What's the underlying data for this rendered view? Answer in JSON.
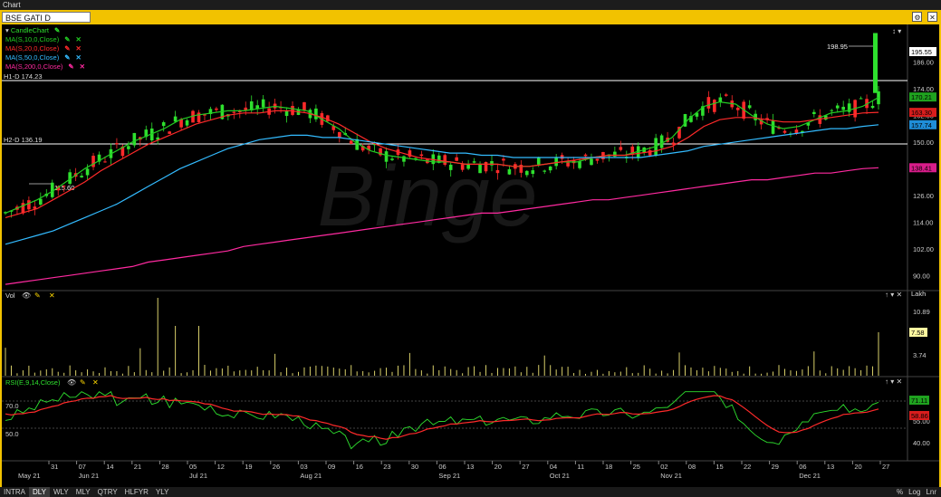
{
  "window": {
    "title": "Chart"
  },
  "symbol": "BSE GATI D",
  "watermark": "Binge",
  "price_panel": {
    "legend": [
      {
        "label": "CandleChart",
        "color": "#2ee02e"
      },
      {
        "label": "MA(S,10,0,Close)",
        "color": "#22cc22"
      },
      {
        "label": "MA(S,20,0,Close)",
        "color": "#ff2a2a"
      },
      {
        "label": "MA(S,50,0,Close)",
        "color": "#33bbff"
      },
      {
        "label": "MA(S,200,0,Close)",
        "color": "#ff2aa0"
      }
    ],
    "h1_label": "H1-D 174.23",
    "h2_label": "H2-D 136.19",
    "high_label": "198.95",
    "low_label": "115.60",
    "y_ticks": [
      "195.55",
      "186.00",
      "174.00",
      "162.00",
      "150.00",
      "138.00",
      "126.00",
      "114.00",
      "102.00",
      "90.00"
    ],
    "y_tick_values": [
      186,
      174,
      162,
      150,
      138,
      126,
      114,
      102,
      90
    ],
    "last_price": "195.55",
    "badges": [
      {
        "text": "170.21",
        "value": 170.21,
        "color": "#1fa21f"
      },
      {
        "text": "163.30",
        "value": 163.3,
        "color": "#d81d1d"
      },
      {
        "text": "157.74",
        "value": 157.74,
        "color": "#1f8ed8"
      },
      {
        "text": "138.41",
        "value": 138.41,
        "color": "#d81d8a"
      }
    ]
  },
  "vol_panel": {
    "label": "Vol",
    "unit": "Lakh",
    "y_ticks": [
      "10.89",
      "3.74"
    ],
    "last": "7.58"
  },
  "rsi_panel": {
    "label": "RSI(E,9,14,Close)",
    "level_high": "70.0",
    "level_low": "50.0",
    "y_ticks": [
      "55.00",
      "40.00"
    ],
    "badges": [
      "71.11",
      "58.86"
    ]
  },
  "x_axis": {
    "ticks": [
      "31",
      "07",
      "14",
      "21",
      "28",
      "05",
      "12",
      "19",
      "26",
      "03",
      "09",
      "16",
      "23",
      "30",
      "06",
      "13",
      "20",
      "27",
      "04",
      "11",
      "18",
      "25",
      "02",
      "08",
      "15",
      "22",
      "29",
      "06",
      "13",
      "20",
      "27"
    ],
    "months": [
      "May 21",
      "Jun 21",
      "Jul 21",
      "Aug 21",
      "Sep 21",
      "Oct 21",
      "Nov 21",
      "Dec 21"
    ]
  },
  "bottom_bar": {
    "intervals": [
      "INTRA",
      "DLY",
      "WLY",
      "MLY",
      "QTRY",
      "HLFYR",
      "YLY"
    ],
    "selected": "DLY",
    "right": [
      "%",
      "Log",
      "Lnr"
    ]
  },
  "chart_data": {
    "type": "line",
    "title": "BSE GATI D",
    "series": [
      {
        "name": "MA(S,10,0,Close)",
        "values": [
          118,
          121,
          124,
          128,
          133,
          138,
          142,
          146,
          150,
          153,
          156,
          160,
          162,
          163,
          164,
          164,
          165,
          166,
          165,
          164,
          160,
          156,
          150,
          146,
          144,
          143,
          142,
          141,
          141,
          140,
          140,
          140,
          139,
          139,
          140,
          141,
          141,
          143,
          144,
          144,
          146,
          148,
          152,
          160,
          166,
          168,
          167,
          162,
          158,
          156,
          157,
          160,
          163,
          164,
          166,
          170
        ]
      },
      {
        "name": "MA(S,20,0,Close)",
        "values": [
          116,
          118,
          120,
          124,
          128,
          132,
          137,
          141,
          145,
          149,
          152,
          155,
          158,
          160,
          162,
          163,
          163,
          164,
          164,
          163,
          161,
          158,
          154,
          150,
          147,
          145,
          143,
          142,
          141,
          140,
          140,
          140,
          139,
          139,
          140,
          141,
          142,
          143,
          144,
          144,
          145,
          146,
          148,
          152,
          157,
          160,
          161,
          161,
          160,
          159,
          159,
          160,
          161,
          162,
          163,
          163.3
        ]
      },
      {
        "name": "MA(S,50,0,Close)",
        "values": [
          104,
          106,
          108,
          110,
          113,
          116,
          119,
          122,
          126,
          130,
          134,
          138,
          141,
          144,
          147,
          149,
          151,
          152,
          153,
          153,
          152,
          152,
          151,
          150,
          149,
          148,
          147,
          146,
          145,
          145,
          144,
          144,
          143,
          143,
          143,
          143,
          143,
          143,
          143,
          143,
          143,
          144,
          145,
          146,
          148,
          149,
          150,
          151,
          152,
          153,
          154,
          155,
          156,
          156,
          157,
          157.74
        ]
      },
      {
        "name": "MA(S,200,0,Close)",
        "values": [
          86,
          87,
          88,
          89,
          90,
          91,
          92,
          93,
          94,
          96,
          97,
          98,
          99,
          100,
          101,
          103,
          104,
          105,
          106,
          107,
          108,
          109,
          110,
          111,
          112,
          113,
          114,
          115,
          116,
          117,
          118,
          118,
          119,
          120,
          121,
          122,
          123,
          124,
          124,
          125,
          126,
          127,
          128,
          129,
          130,
          131,
          132,
          133,
          133,
          134,
          135,
          136,
          136,
          137,
          138,
          138.41
        ]
      }
    ],
    "ylim": [
      84,
      202
    ],
    "grid": false,
    "legend": "top-left"
  }
}
